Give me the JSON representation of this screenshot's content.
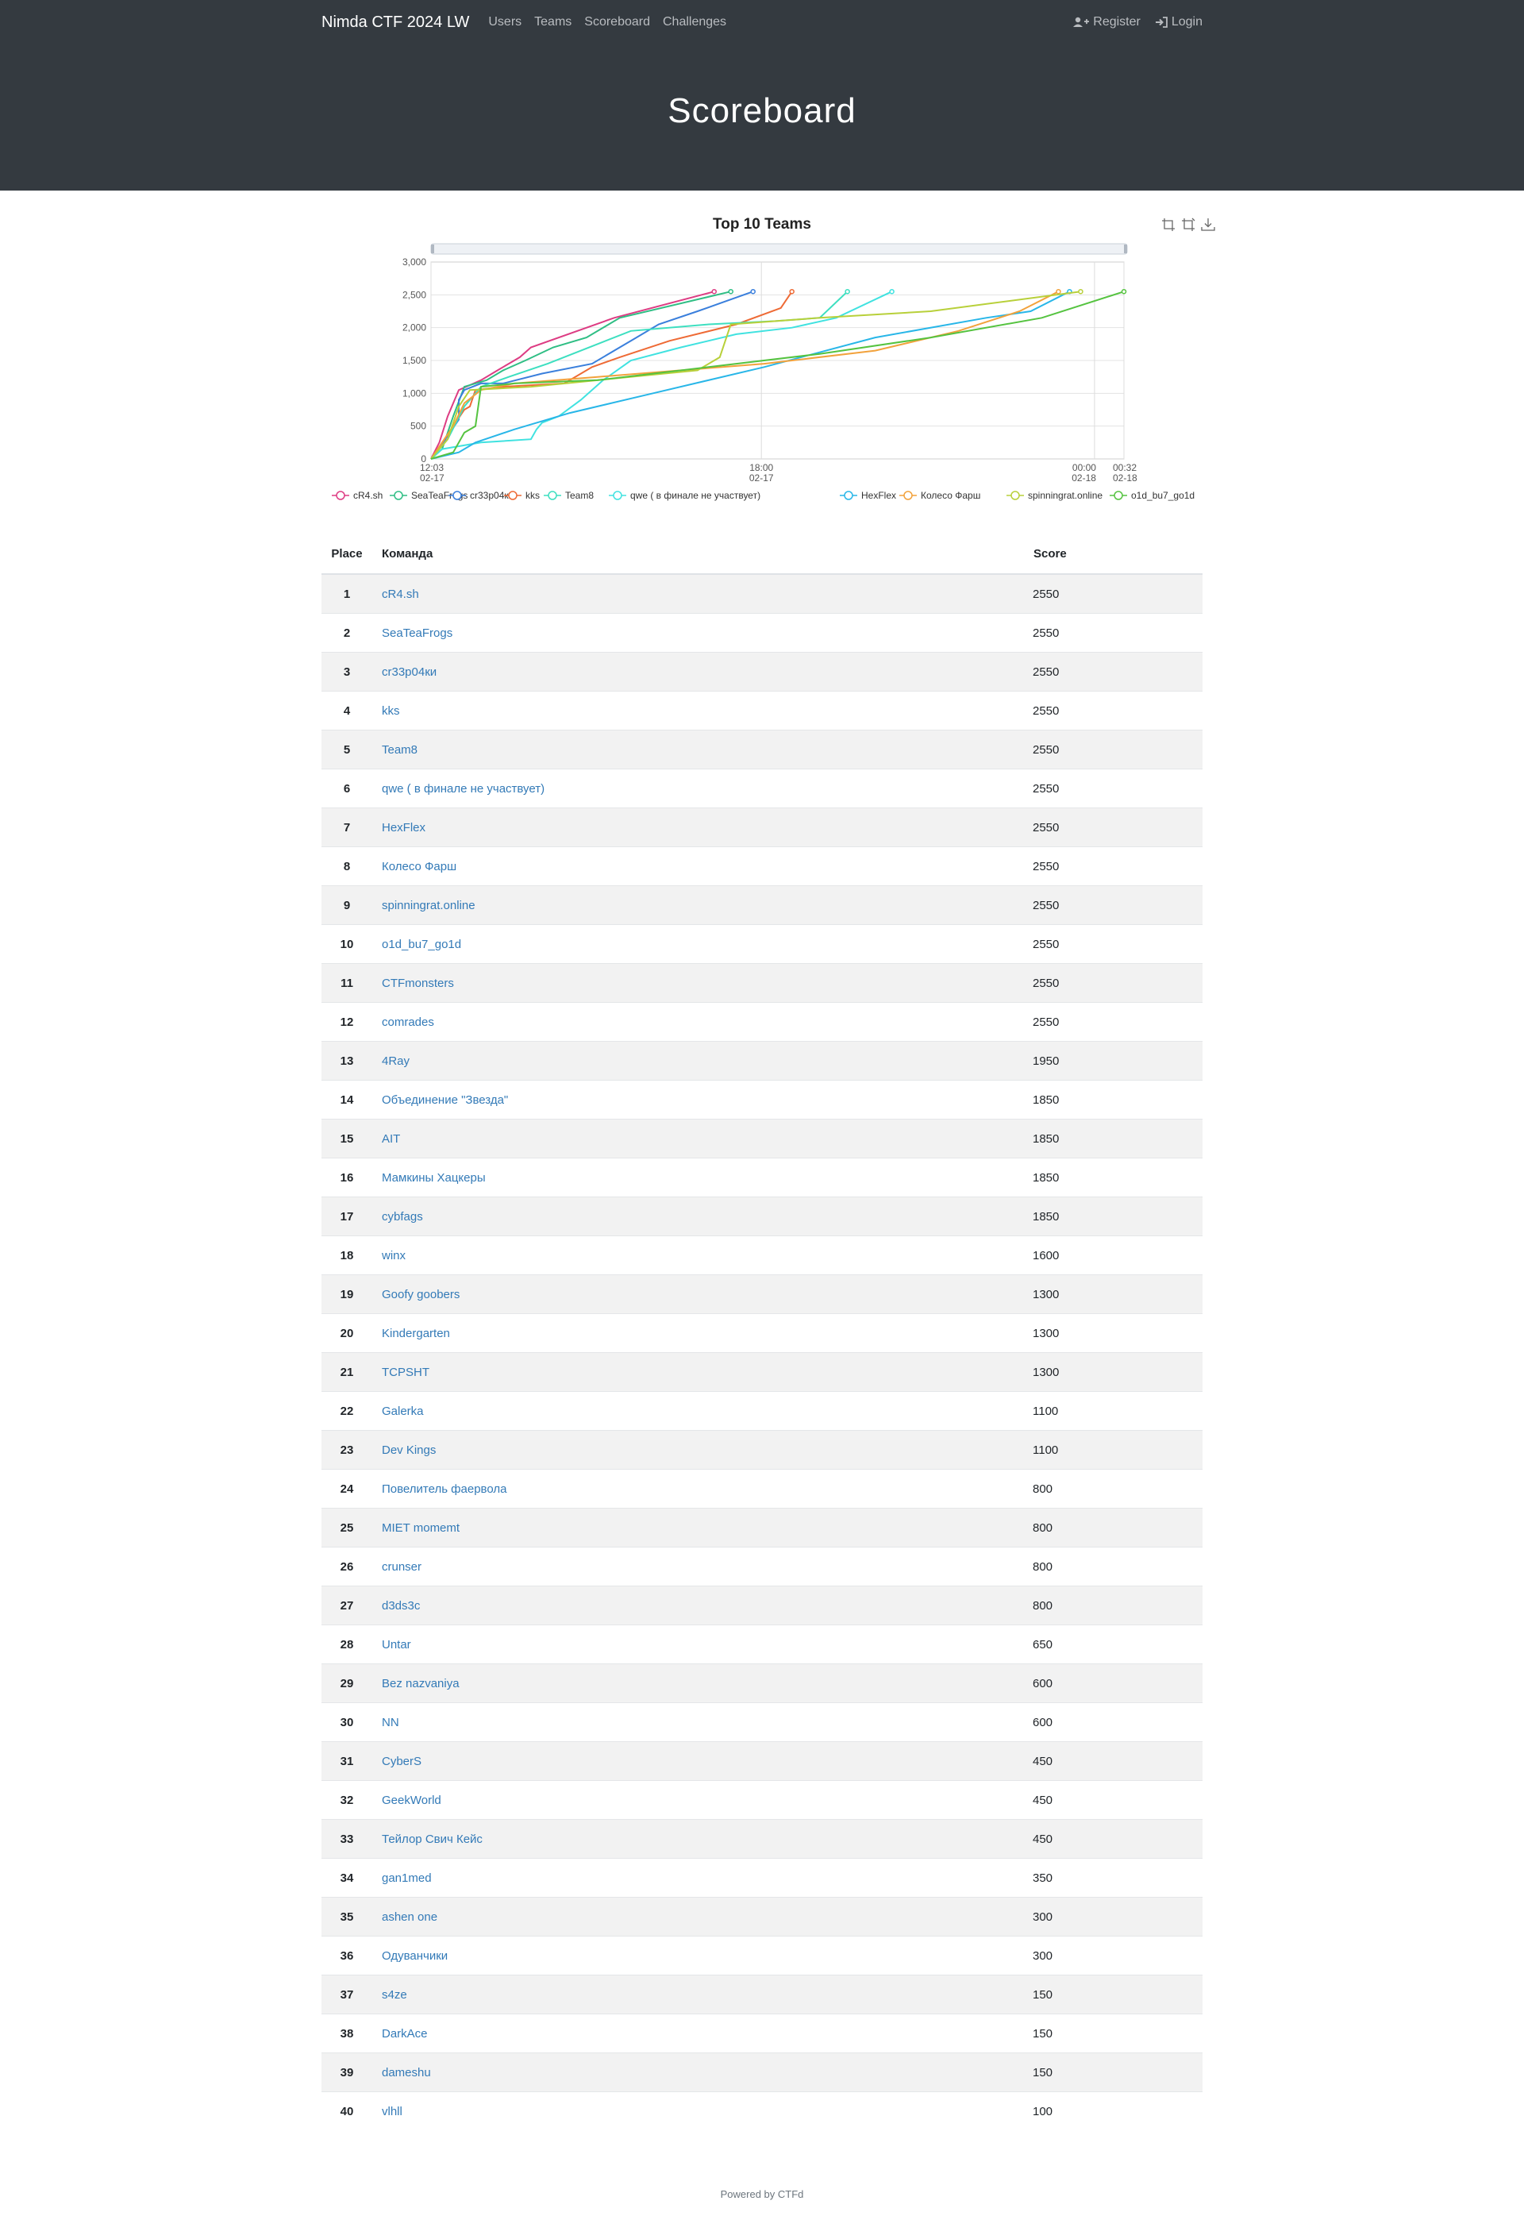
{
  "navbar": {
    "brand": "Nimda CTF 2024 LW",
    "links": [
      "Users",
      "Teams",
      "Scoreboard",
      "Challenges"
    ],
    "register": "Register",
    "login": "Login"
  },
  "page_title": "Scoreboard",
  "table": {
    "headers": [
      "Place",
      "Команда",
      "Score"
    ],
    "rows": [
      [
        "1",
        "cR4.sh",
        "2550"
      ],
      [
        "2",
        "SeaTeaFrogs",
        "2550"
      ],
      [
        "3",
        "cr33p04ки",
        "2550"
      ],
      [
        "4",
        "kks",
        "2550"
      ],
      [
        "5",
        "Team8",
        "2550"
      ],
      [
        "6",
        "qwe ( в финале не участвует)",
        "2550"
      ],
      [
        "7",
        "HexFlex",
        "2550"
      ],
      [
        "8",
        "Колесо Фарш",
        "2550"
      ],
      [
        "9",
        "spinningrat.online",
        "2550"
      ],
      [
        "10",
        "o1d_bu7_go1d",
        "2550"
      ],
      [
        "11",
        "CTFmonsters",
        "2550"
      ],
      [
        "12",
        "comrades",
        "2550"
      ],
      [
        "13",
        "4Ray",
        "1950"
      ],
      [
        "14",
        "Объединение \"Звезда\"",
        "1850"
      ],
      [
        "15",
        "AIT",
        "1850"
      ],
      [
        "16",
        "Мамкины Хацкеры",
        "1850"
      ],
      [
        "17",
        "cybfags",
        "1850"
      ],
      [
        "18",
        "winx",
        "1600"
      ],
      [
        "19",
        "Goofy goobers",
        "1300"
      ],
      [
        "20",
        "Kindergarten",
        "1300"
      ],
      [
        "21",
        "TCPSHT",
        "1300"
      ],
      [
        "22",
        "Galerka",
        "1100"
      ],
      [
        "23",
        "Dev Kings",
        "1100"
      ],
      [
        "24",
        "Повелитель фаервола",
        "800"
      ],
      [
        "25",
        "MIET momemt",
        "800"
      ],
      [
        "26",
        "crunser",
        "800"
      ],
      [
        "27",
        "d3ds3c",
        "800"
      ],
      [
        "28",
        "Untar",
        "650"
      ],
      [
        "29",
        "Bez nazvaniya",
        "600"
      ],
      [
        "30",
        "NN",
        "600"
      ],
      [
        "31",
        "CyberS",
        "450"
      ],
      [
        "32",
        "GeekWorld",
        "450"
      ],
      [
        "33",
        "Тейлор Свич Кейс",
        "450"
      ],
      [
        "34",
        "gan1med",
        "350"
      ],
      [
        "35",
        "ashen one",
        "300"
      ],
      [
        "36",
        "Одуванчики",
        "300"
      ],
      [
        "37",
        "s4ze",
        "150"
      ],
      [
        "38",
        "DarkAce",
        "150"
      ],
      [
        "39",
        "dameshu",
        "150"
      ],
      [
        "40",
        "vlhll",
        "100"
      ]
    ]
  },
  "footer": "Powered by CTFd",
  "chart_data": {
    "type": "line",
    "title": "Top 10 Teams",
    "xlabel": "",
    "ylabel": "",
    "ylim": [
      0,
      3000
    ],
    "yticks": [
      "0",
      "500",
      "1,000",
      "1,500",
      "2,000",
      "2,500",
      "3,000"
    ],
    "xlim_hours": [
      0,
      12.48
    ],
    "xticks": [
      {
        "h": 0,
        "top": "12:03",
        "bottom": "02-17"
      },
      {
        "h": 5.95,
        "top": "18:00",
        "bottom": "02-17"
      },
      {
        "h": 11.95,
        "top": "00:00",
        "bottom": "02-18"
      },
      {
        "h": 12.48,
        "top": "00:32",
        "bottom": "02-18"
      }
    ],
    "grid": true,
    "legend": "bottom",
    "series": [
      {
        "name": "cR4.sh",
        "color": "#dd3c83",
        "points": [
          [
            0,
            0
          ],
          [
            0.15,
            250
          ],
          [
            0.3,
            650
          ],
          [
            0.5,
            1050
          ],
          [
            0.9,
            1200
          ],
          [
            1.2,
            1350
          ],
          [
            1.4,
            1450
          ],
          [
            1.6,
            1550
          ],
          [
            1.8,
            1700
          ],
          [
            3.3,
            2150
          ],
          [
            5.1,
            2550
          ]
        ]
      },
      {
        "name": "SeaTeaFrogs",
        "color": "#2fbe84",
        "points": [
          [
            0,
            0
          ],
          [
            0.2,
            150
          ],
          [
            0.4,
            650
          ],
          [
            0.6,
            1100
          ],
          [
            1.0,
            1200
          ],
          [
            1.3,
            1350
          ],
          [
            1.7,
            1500
          ],
          [
            2.2,
            1700
          ],
          [
            2.8,
            1850
          ],
          [
            3.4,
            2150
          ],
          [
            5.4,
            2550
          ]
        ]
      },
      {
        "name": "cr33p04ки",
        "color": "#3a7fdc",
        "points": [
          [
            0,
            0
          ],
          [
            0.3,
            350
          ],
          [
            0.5,
            600
          ],
          [
            0.5,
            900
          ],
          [
            0.6,
            1050
          ],
          [
            0.9,
            1150
          ],
          [
            1.3,
            1150
          ],
          [
            2.0,
            1300
          ],
          [
            2.9,
            1450
          ],
          [
            3.7,
            1850
          ],
          [
            4.1,
            2050
          ],
          [
            4.8,
            2250
          ],
          [
            5.8,
            2550
          ]
        ]
      },
      {
        "name": "kks",
        "color": "#ee6a35",
        "points": [
          [
            0,
            0
          ],
          [
            0.4,
            500
          ],
          [
            0.6,
            750
          ],
          [
            0.7,
            800
          ],
          [
            0.8,
            1050
          ],
          [
            1.3,
            1100
          ],
          [
            2.4,
            1150
          ],
          [
            2.9,
            1400
          ],
          [
            3.4,
            1550
          ],
          [
            4.3,
            1800
          ],
          [
            5.5,
            2050
          ],
          [
            6.3,
            2300
          ],
          [
            6.5,
            2550
          ]
        ]
      },
      {
        "name": "Team8",
        "color": "#3ddfc0",
        "points": [
          [
            0,
            0
          ],
          [
            0.3,
            300
          ],
          [
            0.6,
            800
          ],
          [
            0.9,
            1100
          ],
          [
            1.4,
            1250
          ],
          [
            2.1,
            1450
          ],
          [
            3.0,
            1750
          ],
          [
            3.6,
            1950
          ],
          [
            5.0,
            2050
          ],
          [
            6.2,
            2100
          ],
          [
            7.0,
            2150
          ],
          [
            7.5,
            2550
          ]
        ]
      },
      {
        "name": "qwe ( в финале не участвует)",
        "color": "#40e2e0",
        "points": [
          [
            0,
            0
          ],
          [
            0.2,
            150
          ],
          [
            0.9,
            250
          ],
          [
            1.8,
            300
          ],
          [
            1.9,
            450
          ],
          [
            2.0,
            550
          ],
          [
            2.3,
            650
          ],
          [
            2.7,
            900
          ],
          [
            3.1,
            1200
          ],
          [
            3.6,
            1500
          ],
          [
            4.5,
            1700
          ],
          [
            5.5,
            1900
          ],
          [
            6.5,
            2000
          ],
          [
            7.3,
            2150
          ],
          [
            8.3,
            2550
          ]
        ]
      },
      {
        "name": "HexFlex",
        "color": "#28b6e8",
        "points": [
          [
            0,
            0
          ],
          [
            0.5,
            100
          ],
          [
            0.8,
            250
          ],
          [
            1.5,
            450
          ],
          [
            2.5,
            700
          ],
          [
            4.0,
            1000
          ],
          [
            6.0,
            1400
          ],
          [
            8.0,
            1850
          ],
          [
            10.0,
            2150
          ],
          [
            10.8,
            2250
          ],
          [
            11.5,
            2550
          ]
        ]
      },
      {
        "name": "Колесо Фарш",
        "color": "#f2a23c",
        "points": [
          [
            0,
            0
          ],
          [
            0.4,
            500
          ],
          [
            0.6,
            850
          ],
          [
            0.9,
            1050
          ],
          [
            1.5,
            1150
          ],
          [
            3.0,
            1250
          ],
          [
            4.5,
            1350
          ],
          [
            6.0,
            1450
          ],
          [
            8.0,
            1650
          ],
          [
            9.5,
            1950
          ],
          [
            10.6,
            2250
          ],
          [
            11.3,
            2550
          ]
        ]
      },
      {
        "name": "spinningrat.online",
        "color": "#b8d03a",
        "points": [
          [
            0,
            0
          ],
          [
            0.3,
            300
          ],
          [
            0.5,
            800
          ],
          [
            0.7,
            1050
          ],
          [
            1.8,
            1100
          ],
          [
            4.8,
            1350
          ],
          [
            5.2,
            1550
          ],
          [
            5.4,
            2050
          ],
          [
            7.0,
            2150
          ],
          [
            9.0,
            2250
          ],
          [
            11.7,
            2550
          ]
        ]
      },
      {
        "name": "o1d_bu7_go1d",
        "color": "#55c340",
        "points": [
          [
            0,
            0
          ],
          [
            0.4,
            100
          ],
          [
            0.6,
            400
          ],
          [
            0.8,
            500
          ],
          [
            0.9,
            1100
          ],
          [
            1.5,
            1150
          ],
          [
            3.0,
            1200
          ],
          [
            5.0,
            1400
          ],
          [
            7.0,
            1600
          ],
          [
            9.0,
            1850
          ],
          [
            11.0,
            2150
          ],
          [
            12.48,
            2550
          ]
        ]
      }
    ]
  }
}
